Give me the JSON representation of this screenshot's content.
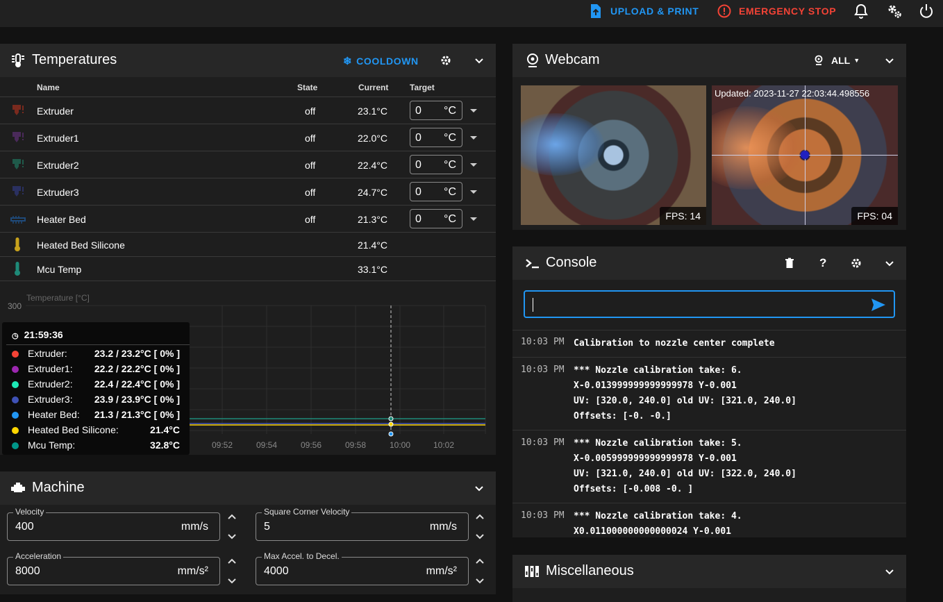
{
  "topbar": {
    "upload_label": "UPLOAD & PRINT",
    "estop_label": "EMERGENCY STOP",
    "accent": "#2196f3",
    "danger": "#f44336"
  },
  "temperatures": {
    "title": "Temperatures",
    "cooldown_label": "COOLDOWN",
    "headers": {
      "name": "Name",
      "state": "State",
      "current": "Current",
      "target": "Target"
    },
    "rows": [
      {
        "name": "Extruder",
        "state": "off",
        "current": "23.1°C",
        "target": "0",
        "unit": "°C",
        "icon_color": "#7a2a1e"
      },
      {
        "name": "Extruder1",
        "state": "off",
        "current": "22.0°C",
        "target": "0",
        "unit": "°C",
        "icon_color": "#4a2a5a"
      },
      {
        "name": "Extruder2",
        "state": "off",
        "current": "22.4°C",
        "target": "0",
        "unit": "°C",
        "icon_color": "#1f5a4a"
      },
      {
        "name": "Extruder3",
        "state": "off",
        "current": "24.7°C",
        "target": "0",
        "unit": "°C",
        "icon_color": "#2a3060"
      },
      {
        "name": "Heater Bed",
        "state": "off",
        "current": "21.3°C",
        "target": "0",
        "unit": "°C",
        "icon_color": "#1f4a7a"
      },
      {
        "name": "Heated Bed Silicone",
        "state": "",
        "current": "21.4°C",
        "icon_color": "#c8a21c"
      },
      {
        "name": "Mcu Temp",
        "state": "",
        "current": "33.1°C",
        "icon_color": "#1e8a78"
      }
    ]
  },
  "chart": {
    "ylabel": "Temperature [°C]",
    "ytick_top": "300",
    "xticks": [
      "09:52",
      "09:54",
      "09:56",
      "09:58",
      "10:00",
      "10:02"
    ]
  },
  "tooltip": {
    "time": "21:59:36",
    "entries": [
      {
        "label": "Extruder:",
        "value": "23.2 / 23.2°C [ 0% ]",
        "color": "#f44336"
      },
      {
        "label": "Extruder1:",
        "value": "22.2 / 22.2°C [ 0% ]",
        "color": "#9c27b0"
      },
      {
        "label": "Extruder2:",
        "value": "22.4 / 22.4°C [ 0% ]",
        "color": "#1de9b6"
      },
      {
        "label": "Extruder3:",
        "value": "23.9 / 23.9°C [ 0% ]",
        "color": "#3f51b5"
      },
      {
        "label": "Heater Bed:",
        "value": "21.3 / 21.3°C [ 0% ]",
        "color": "#2196f3"
      },
      {
        "label": "Heated Bed Silicone:",
        "value": "21.4°C",
        "color": "#ffd600"
      },
      {
        "label": "Mcu Temp:",
        "value": "32.8°C",
        "color": "#009688"
      }
    ]
  },
  "machine": {
    "title": "Machine",
    "fields": [
      {
        "label": "Velocity",
        "value": "400",
        "unit": "mm/s"
      },
      {
        "label": "Square Corner Velocity",
        "value": "5",
        "unit": "mm/s"
      },
      {
        "label": "Acceleration",
        "value": "8000",
        "unit": "mm/s²"
      },
      {
        "label": "Max Accel. to Decel.",
        "value": "4000",
        "unit": "mm/s²"
      }
    ]
  },
  "webcam": {
    "title": "Webcam",
    "filter_label": "ALL",
    "updated_text": "Updated: 2023-11-27 22:03:44.498556",
    "fps1": "FPS: 14",
    "fps2": "FPS: 04"
  },
  "console": {
    "title": "Console",
    "input_value": "",
    "entries": [
      {
        "time": "10:03 PM",
        "message": "Calibration to nozzle center complete"
      },
      {
        "time": "10:03 PM",
        "message": "*** Nozzle calibration take: 6.\nX-0.013999999999999978 Y-0.001\nUV: [320.0, 240.0] old UV: [321.0, 240.0]\nOffsets: [-0. -0.]"
      },
      {
        "time": "10:03 PM",
        "message": "*** Nozzle calibration take: 5.\nX-0.005999999999999978 Y-0.001\nUV: [321.0, 240.0] old UV: [322.0, 240.0]\nOffsets: [-0.008 -0. ]"
      },
      {
        "time": "10:03 PM",
        "message": "*** Nozzle calibration take: 4.\nX0.011000000000000024 Y-0.001"
      }
    ]
  },
  "misc": {
    "title": "Miscellaneous"
  }
}
